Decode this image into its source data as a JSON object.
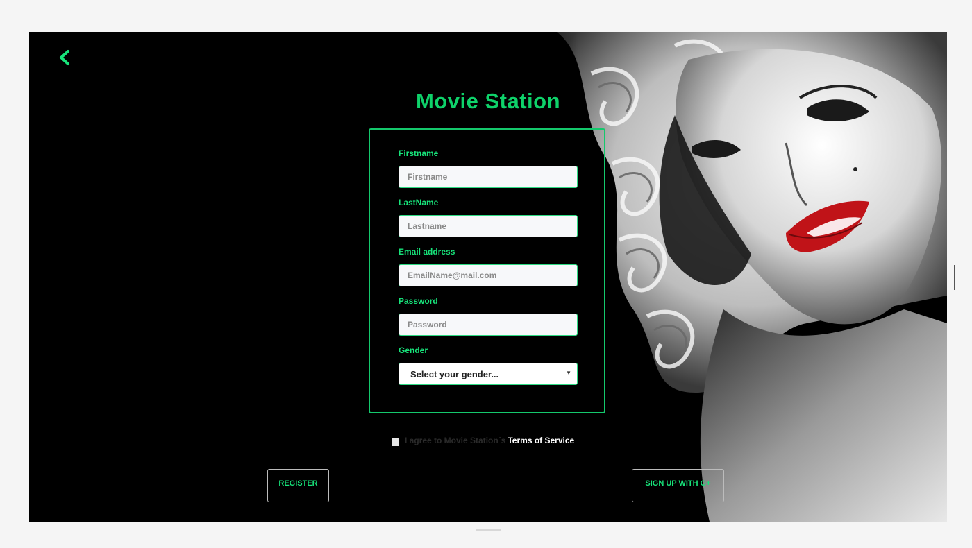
{
  "app": {
    "title": "Movie Station"
  },
  "form": {
    "fields": [
      {
        "label": "Firstname",
        "placeholder": "Firstname"
      },
      {
        "label": "LastName",
        "placeholder": "Lastname"
      },
      {
        "label": "Email address",
        "placeholder": "EmailName@mail.com"
      },
      {
        "label": "Password",
        "placeholder": "Password"
      }
    ],
    "gender": {
      "label": "Gender",
      "selected": "Select your gender..."
    }
  },
  "terms": {
    "text": "I agree to Movie Station´s",
    "link": "Terms of Service"
  },
  "buttons": {
    "register": "REGISTER",
    "google": "SIGN UP WITH G+"
  },
  "colors": {
    "accent": "#17e37a",
    "background": "#000000",
    "lips": "#c01318"
  },
  "icons": {
    "back": "chevron-left-icon",
    "select": "caret-down-icon"
  }
}
